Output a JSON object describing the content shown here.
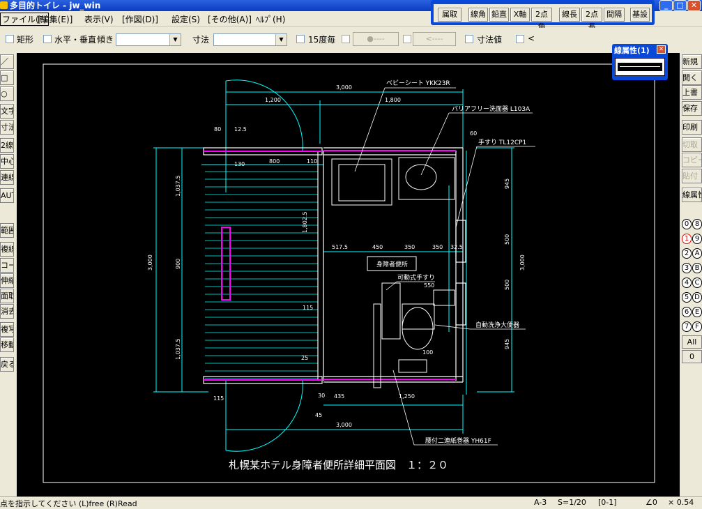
{
  "window": {
    "title": "多目的トイレ - jw_win"
  },
  "menu": {
    "file": "ファイル(F)",
    "items": [
      "[編集(E)]",
      "表示(V)",
      "[作図(D)]",
      "設定(S)",
      "[その他(A)]",
      "ﾍﾙﾌﾟ(H)"
    ]
  },
  "floatbar": {
    "buttons": [
      "属取",
      "線角",
      "鉛直",
      "X軸",
      "2点角",
      "線長",
      "2点長",
      "間隔",
      "基設"
    ]
  },
  "options": {
    "rect": "矩形",
    "hv": "水平・垂直",
    "tilt": "傾き",
    "dim": "寸法",
    "deg15": "15度毎",
    "seg1": "●----",
    "seg2": "<----",
    "dimval": "寸法値",
    "lt": "<"
  },
  "leftbar": {
    "items": [
      "／",
      "□",
      "○",
      "文字",
      "寸法",
      "2線",
      "中心線",
      "連線",
      "AUTO",
      "範囲",
      "複線",
      "コーナー",
      "伸縮",
      "面取",
      "消去",
      "複写",
      "移動",
      "戻る"
    ]
  },
  "rightbar": {
    "items": [
      "新規",
      "開く",
      "上書",
      "保存",
      "印刷",
      "切取",
      "コピー",
      "貼付",
      "線属性"
    ],
    "numbers_left": [
      "0",
      "1",
      "2",
      "3",
      "4",
      "5",
      "6",
      "7"
    ],
    "numbers_right": [
      "8",
      "9",
      "A",
      "B",
      "C",
      "D",
      "E",
      "F"
    ],
    "all": "All",
    "zero": "0"
  },
  "lineattr": {
    "title": "線属性(1)"
  },
  "drawing": {
    "title": "札幌某ホテル身障者便所詳細平面図　１：２０",
    "labels": {
      "baby": "ベビーシート YKK23R",
      "sink": "バリアフリー洗面器 L103A",
      "rail": "手すり TL12CP1",
      "room": "身障者便所",
      "movrail": "可動式手すり",
      "toilet": "自動洗浄大便器",
      "paper": "腰付二連紙巻器 YH61F"
    },
    "dims": {
      "d3000": "3,000",
      "d1200": "1,200",
      "d1800": "1,800",
      "d800": "800",
      "d110": "110",
      "d5175": "517.5",
      "d450": "450",
      "d350": "350",
      "d325": "32.5",
      "d10375": "1,037.5",
      "d900": "900",
      "d125": "12.5",
      "d945": "945",
      "d500": "500",
      "d115": "115",
      "d435": "435",
      "d1250": "1,250",
      "d80": "80",
      "d130": "130",
      "d25": "25",
      "d45": "45",
      "d100": "100",
      "d550": "550",
      "d60": "60",
      "d18025": "1,802.5",
      "d30": "30"
    }
  },
  "status": {
    "prompt": "点を指示してください (L)free (R)Read",
    "paper": "A-3",
    "scale": "S=1/20",
    "layer": "[0-1]",
    "angle": "∠0",
    "zoom": "× 0.54"
  }
}
